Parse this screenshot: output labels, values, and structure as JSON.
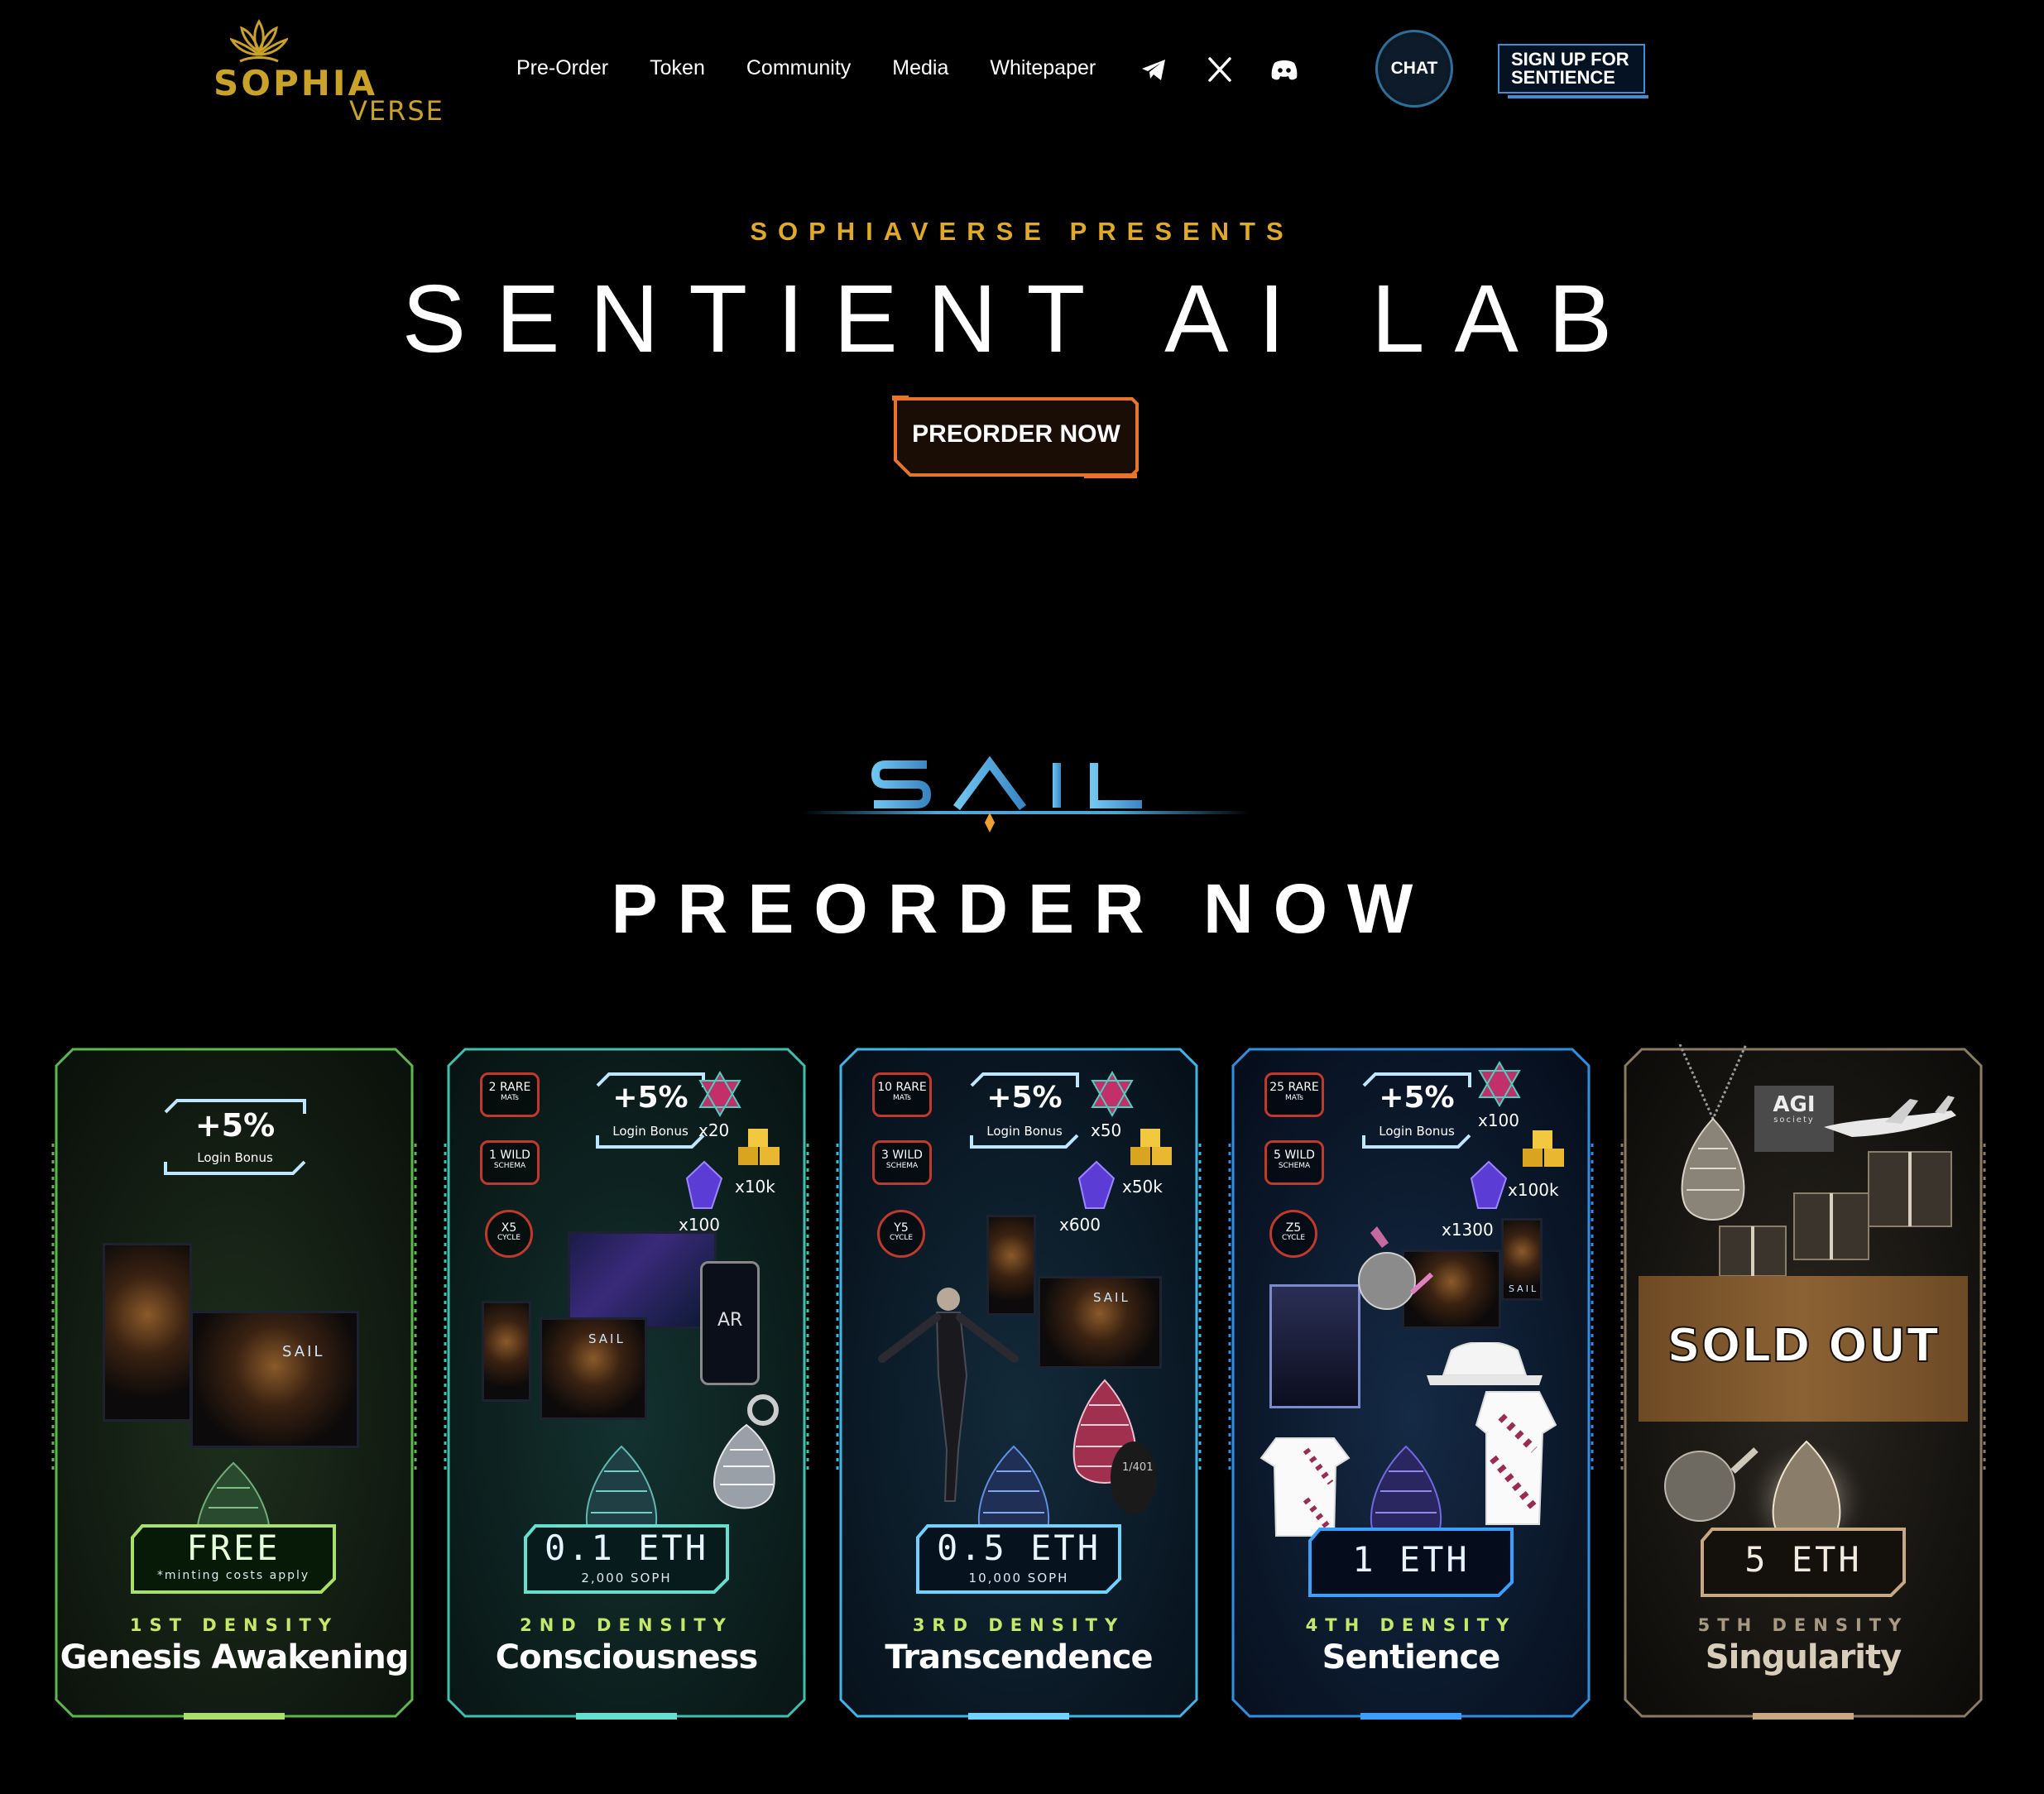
{
  "brand": {
    "name_top": "SOPHIA",
    "name_bottom": "VERSE",
    "color": "#c9a227"
  },
  "nav": {
    "links": [
      "Pre-Order",
      "Token",
      "Community",
      "Media",
      "Whitepaper"
    ],
    "social_icons": [
      "telegram-icon",
      "x-icon",
      "discord-icon"
    ],
    "chat_label": "CHAT",
    "signup_label": "SIGN UP FOR SENTIENCE"
  },
  "hero": {
    "presents": "SOPHIAVERSE PRESENTS",
    "title": "SENTIENT AI LAB",
    "cta": "PREORDER NOW",
    "accent": "#e0a928",
    "cta_border": "#e8742a"
  },
  "sail": {
    "logo_text": "SAIL",
    "heading": "PREORDER NOW",
    "logo_color": "#5fb8e6"
  },
  "cards": [
    {
      "density": "1ST DENSITY",
      "name": "Genesis Awakening",
      "price": "FREE",
      "price_sub": "*minting costs apply",
      "bonus": "+5%",
      "bonus_label": "Login Bonus",
      "poster_tag": "SAIL",
      "color": "#7ed957"
    },
    {
      "density": "2ND DENSITY",
      "name": "Consciousness",
      "price": "0.1 ETH",
      "price_sub": "2,000 SOPH",
      "bonus": "+5%",
      "bonus_label": "Login Bonus",
      "rare": "2 RARE",
      "rare_sub": "MATs",
      "wild": "1 WILD",
      "wild_sub": "SCHEMA",
      "cycle": "X5",
      "cycle_sub": "CYCLE",
      "qty_star": "x20",
      "qty_crystal": "x10k",
      "qty_poster": "x100",
      "ar": "AR",
      "poster_tag": "SAIL",
      "color": "#4fd1c5"
    },
    {
      "density": "3RD DENSITY",
      "name": "Transcendence",
      "price": "0.5 ETH",
      "price_sub": "10,000 SOPH",
      "bonus": "+5%",
      "bonus_label": "Login Bonus",
      "rare": "10 RARE",
      "rare_sub": "MATs",
      "wild": "3 WILD",
      "wild_sub": "SCHEMA",
      "cycle": "Y5",
      "cycle_sub": "CYCLE",
      "qty_star": "x50",
      "qty_crystal": "x50k",
      "qty_poster": "x600",
      "egg_number": "1/401",
      "poster_tag": "SAIL",
      "color": "#3fb6e8"
    },
    {
      "density": "4TH DENSITY",
      "name": "Sentience",
      "price": "1 ETH",
      "price_sub": "",
      "bonus": "+5%",
      "bonus_label": "Login Bonus",
      "rare": "25 RARE",
      "rare_sub": "MATs",
      "wild": "5 WILD",
      "wild_sub": "SCHEMA",
      "cycle": "Z5",
      "cycle_sub": "CYCLE",
      "qty_star": "x100",
      "qty_crystal": "x100k",
      "qty_poster": "x1300",
      "poster_tag": "SAIL",
      "color": "#2f8fe0"
    },
    {
      "density": "5TH DENSITY",
      "name": "Singularity",
      "price": "5 ETH",
      "price_sub": "",
      "status": "SOLD OUT",
      "agi": "AGI",
      "agi_sub": "society",
      "color": "#c8b89a"
    }
  ]
}
